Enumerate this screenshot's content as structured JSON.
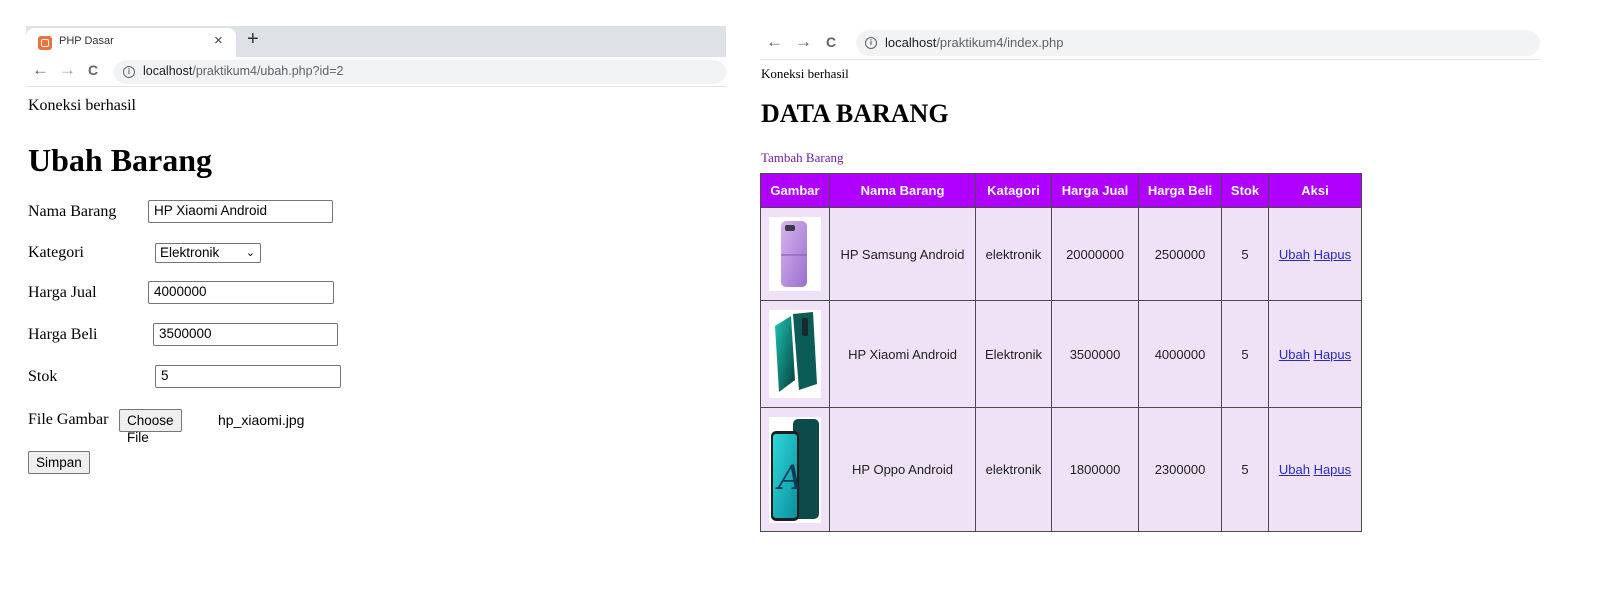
{
  "left_browser": {
    "tab_title": "PHP Dasar",
    "tab_close": "×",
    "new_tab": "+",
    "nav": {
      "back": "←",
      "forward": "→",
      "reload": "C"
    },
    "url_host": "localhost",
    "url_path": "/praktikum4/ubah.php?id=2"
  },
  "edit_page": {
    "status": "Koneksi berhasil",
    "title": "Ubah Barang",
    "fields": {
      "nama_label": "Nama Barang",
      "nama_value": "HP Xiaomi Android",
      "kategori_label": "Kategori",
      "kategori_value": "Elektronik",
      "harga_jual_label": "Harga Jual",
      "harga_jual_value": "4000000",
      "harga_beli_label": "Harga Beli",
      "harga_beli_value": "3500000",
      "stok_label": "Stok",
      "stok_value": "5",
      "file_label": "File Gambar",
      "file_button": "Choose File",
      "file_name": "hp_xiaomi.jpg"
    },
    "submit_label": "Simpan"
  },
  "right_browser": {
    "nav": {
      "back": "←",
      "forward": "→",
      "reload": "C"
    },
    "url_host": "localhost",
    "url_path": "/praktikum4/index.php"
  },
  "list_page": {
    "status": "Koneksi berhasil",
    "title": "DATA BARANG",
    "add_link": "Tambah Barang",
    "columns": [
      "Gambar",
      "Nama Barang",
      "Katagori",
      "Harga Jual",
      "Harga Beli",
      "Stok",
      "Aksi"
    ],
    "rows": [
      {
        "image": "samsung-flip-phone",
        "nama": "HP Samsung Android",
        "kategori": "elektronik",
        "harga_jual": "20000000",
        "harga_beli": "2500000",
        "stok": "5",
        "ubah": "Ubah",
        "hapus": "Hapus"
      },
      {
        "image": "xiaomi-phone",
        "nama": "HP Xiaomi Android",
        "kategori": "Elektronik",
        "harga_jual": "3500000",
        "harga_beli": "4000000",
        "stok": "5",
        "ubah": "Ubah",
        "hapus": "Hapus"
      },
      {
        "image": "oppo-phone",
        "nama": "HP Oppo Android",
        "kategori": "elektronik",
        "harga_jual": "1800000",
        "harga_beli": "2300000",
        "stok": "5",
        "ubah": "Ubah",
        "hapus": "Hapus"
      }
    ]
  },
  "colors": {
    "table_header": "#b000ff",
    "table_cell": "#efe1f6",
    "link": "#2a2acc",
    "visited_link": "#681da8"
  }
}
